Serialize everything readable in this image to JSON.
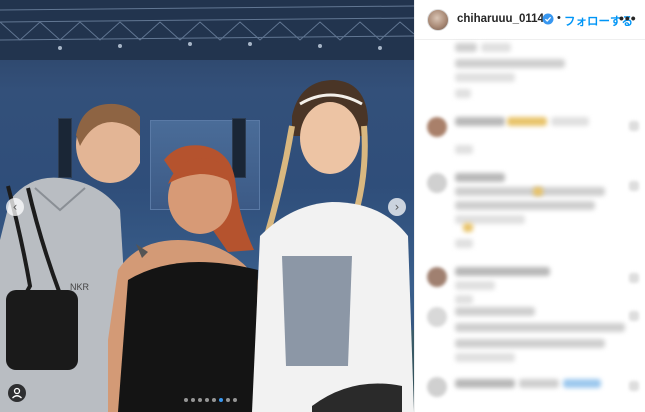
{
  "post": {
    "username": "chiharuuu_0114",
    "follow_label": "フォローする",
    "separator": "•",
    "more_label": "•••",
    "verified": true,
    "carousel": {
      "slide_count": 8,
      "active_index": 5,
      "prev_icon": "‹",
      "next_icon": "›"
    }
  },
  "colors": {
    "accent": "#0095f6",
    "verified": "#3897f0"
  }
}
